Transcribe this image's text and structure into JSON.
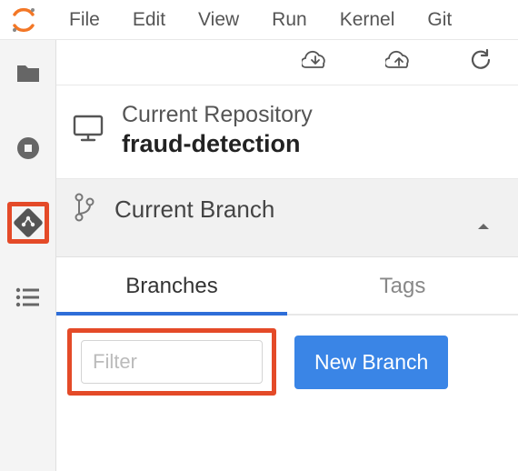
{
  "menu": {
    "file": "File",
    "edit": "Edit",
    "view": "View",
    "run": "Run",
    "kernel": "Kernel",
    "git": "Git"
  },
  "repo": {
    "label": "Current Repository",
    "name": "fraud-detection"
  },
  "branch": {
    "label": "Current Branch"
  },
  "tabs": {
    "branches": "Branches",
    "tags": "Tags"
  },
  "filter": {
    "placeholder": "Filter"
  },
  "buttons": {
    "newBranch": "New Branch"
  }
}
